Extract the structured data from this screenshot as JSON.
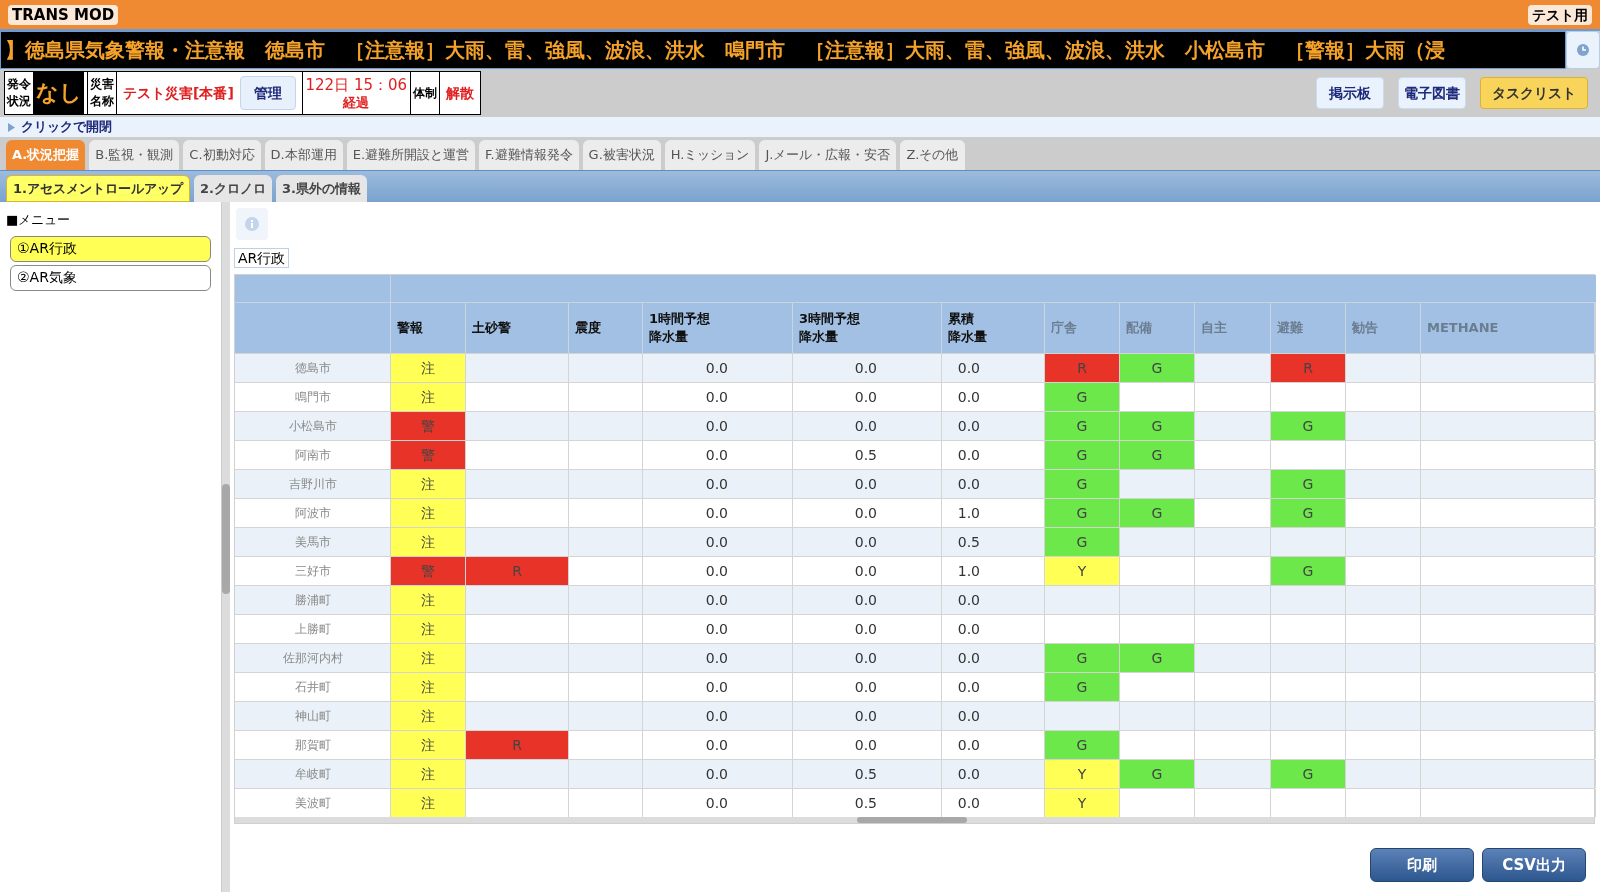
{
  "title_bar": {
    "app_name": "TRANS MOD",
    "badge": "テスト用"
  },
  "ticker": "】徳島県気象警報・注意報　徳島市　［注意報］大雨、雷、強風、波浪、洪水　鳴門市　［注意報］大雨、雷、強風、波浪、洪水　小松島市　［警報］大雨（浸",
  "status": {
    "issue_label": [
      "発令",
      "状況"
    ],
    "issue_value": "なし",
    "disaster_label": [
      "災害",
      "名称"
    ],
    "disaster_name": "テスト災害[本番]",
    "manage_button": "管理",
    "elapsed": "122日 15：06",
    "elapsed_label": "経過",
    "system_label": "体制",
    "system_value": "解散"
  },
  "top_buttons": [
    {
      "label": "掲示板",
      "kind": "plain"
    },
    {
      "label": "電子図書",
      "kind": "plain"
    },
    {
      "label": "タスクリスト",
      "kind": "accent"
    }
  ],
  "toggle_label": "クリックで開閉",
  "tabs": [
    {
      "label": "A.状況把握",
      "selected": true
    },
    {
      "label": "B.監視・観測",
      "selected": false
    },
    {
      "label": "C.初動対応",
      "selected": false
    },
    {
      "label": "D.本部運用",
      "selected": false
    },
    {
      "label": "E.避難所開設と運営",
      "selected": false
    },
    {
      "label": "F.避難情報発令",
      "selected": false
    },
    {
      "label": "G.被害状況",
      "selected": false
    },
    {
      "label": "H.ミッション",
      "selected": false
    },
    {
      "label": "J.メール・広報・安否",
      "selected": false
    },
    {
      "label": "Z.その他",
      "selected": false
    }
  ],
  "subtabs": [
    {
      "label": "1.アセスメントロールアップ",
      "selected": true
    },
    {
      "label": "2.クロノロ",
      "selected": false
    },
    {
      "label": "3.県外の情報",
      "selected": false
    }
  ],
  "menu": {
    "title": "■メニュー",
    "items": [
      {
        "label": "①AR行政",
        "selected": true
      },
      {
        "label": "②AR気象",
        "selected": false
      }
    ]
  },
  "section_label": "AR行政",
  "table": {
    "columns": [
      {
        "lines": [
          "警報"
        ],
        "dim": false
      },
      {
        "lines": [
          "土砂警"
        ],
        "dim": false
      },
      {
        "lines": [
          "震度"
        ],
        "dim": false
      },
      {
        "lines": [
          "1時間予想",
          "降水量"
        ],
        "dim": false
      },
      {
        "lines": [
          "3時間予想",
          "降水量"
        ],
        "dim": false
      },
      {
        "lines": [
          "累積",
          "降水量"
        ],
        "dim": false
      },
      {
        "lines": [
          "庁舎"
        ],
        "dim": true
      },
      {
        "lines": [
          "配備"
        ],
        "dim": true
      },
      {
        "lines": [
          "自主"
        ],
        "dim": true
      },
      {
        "lines": [
          "避難"
        ],
        "dim": true
      },
      {
        "lines": [
          "勧告"
        ],
        "dim": true
      },
      {
        "lines": [
          "METHANE"
        ],
        "dim": true
      }
    ],
    "rows": [
      {
        "name": "徳島市",
        "cells": [
          {
            "text": "注",
            "color": "#ffff55"
          },
          null,
          null,
          {
            "text": "0.0"
          },
          {
            "text": "0.0"
          },
          {
            "text": "0.0"
          },
          {
            "text": "R",
            "color": "#e83428"
          },
          {
            "text": "G",
            "color": "#6ce84a"
          },
          null,
          {
            "text": "R",
            "color": "#e83428"
          },
          null,
          null
        ]
      },
      {
        "name": "鳴門市",
        "cells": [
          {
            "text": "注",
            "color": "#ffff55"
          },
          null,
          null,
          {
            "text": "0.0"
          },
          {
            "text": "0.0"
          },
          {
            "text": "0.0"
          },
          {
            "text": "G",
            "color": "#6ce84a"
          },
          null,
          null,
          null,
          null,
          null
        ]
      },
      {
        "name": "小松島市",
        "cells": [
          {
            "text": "警",
            "color": "#e83428"
          },
          null,
          null,
          {
            "text": "0.0"
          },
          {
            "text": "0.0"
          },
          {
            "text": "0.0"
          },
          {
            "text": "G",
            "color": "#6ce84a"
          },
          {
            "text": "G",
            "color": "#6ce84a"
          },
          null,
          {
            "text": "G",
            "color": "#6ce84a"
          },
          null,
          null
        ]
      },
      {
        "name": "阿南市",
        "cells": [
          {
            "text": "警",
            "color": "#e83428"
          },
          null,
          null,
          {
            "text": "0.0"
          },
          {
            "text": "0.5"
          },
          {
            "text": "0.0"
          },
          {
            "text": "G",
            "color": "#6ce84a"
          },
          {
            "text": "G",
            "color": "#6ce84a"
          },
          null,
          null,
          null,
          null
        ]
      },
      {
        "name": "吉野川市",
        "cells": [
          {
            "text": "注",
            "color": "#ffff55"
          },
          null,
          null,
          {
            "text": "0.0"
          },
          {
            "text": "0.0"
          },
          {
            "text": "0.0"
          },
          {
            "text": "G",
            "color": "#6ce84a"
          },
          null,
          null,
          {
            "text": "G",
            "color": "#6ce84a"
          },
          null,
          null
        ]
      },
      {
        "name": "阿波市",
        "cells": [
          {
            "text": "注",
            "color": "#ffff55"
          },
          null,
          null,
          {
            "text": "0.0"
          },
          {
            "text": "0.0"
          },
          {
            "text": "1.0"
          },
          {
            "text": "G",
            "color": "#6ce84a"
          },
          {
            "text": "G",
            "color": "#6ce84a"
          },
          null,
          {
            "text": "G",
            "color": "#6ce84a"
          },
          null,
          null
        ]
      },
      {
        "name": "美馬市",
        "cells": [
          {
            "text": "注",
            "color": "#ffff55"
          },
          null,
          null,
          {
            "text": "0.0"
          },
          {
            "text": "0.0"
          },
          {
            "text": "0.5"
          },
          {
            "text": "G",
            "color": "#6ce84a"
          },
          null,
          null,
          null,
          null,
          null
        ]
      },
      {
        "name": "三好市",
        "cells": [
          {
            "text": "警",
            "color": "#e83428"
          },
          {
            "text": "R",
            "color": "#e83428"
          },
          null,
          {
            "text": "0.0"
          },
          {
            "text": "0.0"
          },
          {
            "text": "1.0"
          },
          {
            "text": "Y",
            "color": "#ffff55"
          },
          null,
          null,
          {
            "text": "G",
            "color": "#6ce84a"
          },
          null,
          null
        ]
      },
      {
        "name": "勝浦町",
        "cells": [
          {
            "text": "注",
            "color": "#ffff55"
          },
          null,
          null,
          {
            "text": "0.0"
          },
          {
            "text": "0.0"
          },
          {
            "text": "0.0"
          },
          null,
          null,
          null,
          null,
          null,
          null
        ]
      },
      {
        "name": "上勝町",
        "cells": [
          {
            "text": "注",
            "color": "#ffff55"
          },
          null,
          null,
          {
            "text": "0.0"
          },
          {
            "text": "0.0"
          },
          {
            "text": "0.0"
          },
          null,
          null,
          null,
          null,
          null,
          null
        ]
      },
      {
        "name": "佐那河内村",
        "cells": [
          {
            "text": "注",
            "color": "#ffff55"
          },
          null,
          null,
          {
            "text": "0.0"
          },
          {
            "text": "0.0"
          },
          {
            "text": "0.0"
          },
          {
            "text": "G",
            "color": "#6ce84a"
          },
          {
            "text": "G",
            "color": "#6ce84a"
          },
          null,
          null,
          null,
          null
        ]
      },
      {
        "name": "石井町",
        "cells": [
          {
            "text": "注",
            "color": "#ffff55"
          },
          null,
          null,
          {
            "text": "0.0"
          },
          {
            "text": "0.0"
          },
          {
            "text": "0.0"
          },
          {
            "text": "G",
            "color": "#6ce84a"
          },
          null,
          null,
          null,
          null,
          null
        ]
      },
      {
        "name": "神山町",
        "cells": [
          {
            "text": "注",
            "color": "#ffff55"
          },
          null,
          null,
          {
            "text": "0.0"
          },
          {
            "text": "0.0"
          },
          {
            "text": "0.0"
          },
          null,
          null,
          null,
          null,
          null,
          null
        ]
      },
      {
        "name": "那賀町",
        "cells": [
          {
            "text": "注",
            "color": "#ffff55"
          },
          {
            "text": "R",
            "color": "#e83428"
          },
          null,
          {
            "text": "0.0"
          },
          {
            "text": "0.0"
          },
          {
            "text": "0.0"
          },
          {
            "text": "G",
            "color": "#6ce84a"
          },
          null,
          null,
          null,
          null,
          null
        ]
      },
      {
        "name": "牟岐町",
        "cells": [
          {
            "text": "注",
            "color": "#ffff55"
          },
          null,
          null,
          {
            "text": "0.0"
          },
          {
            "text": "0.5"
          },
          {
            "text": "0.0"
          },
          {
            "text": "Y",
            "color": "#ffff55"
          },
          {
            "text": "G",
            "color": "#6ce84a"
          },
          null,
          {
            "text": "G",
            "color": "#6ce84a"
          },
          null,
          null
        ]
      },
      {
        "name": "美波町",
        "cells": [
          {
            "text": "注",
            "color": "#ffff55"
          },
          null,
          null,
          {
            "text": "0.0"
          },
          {
            "text": "0.5"
          },
          {
            "text": "0.0"
          },
          {
            "text": "Y",
            "color": "#ffff55"
          },
          null,
          null,
          null,
          null,
          null
        ]
      }
    ]
  },
  "bottom_buttons": [
    "印刷",
    "CSV出力"
  ]
}
